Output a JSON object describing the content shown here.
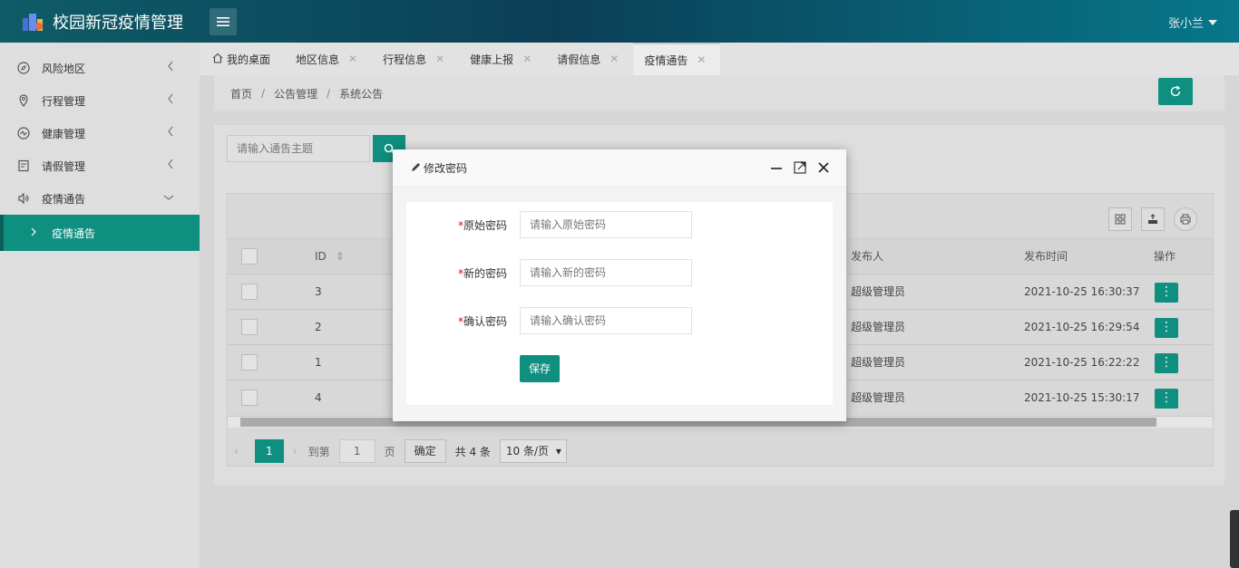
{
  "header": {
    "app_title": "校园新冠疫情管理",
    "user_name": "张小兰"
  },
  "sidebar": {
    "items": [
      {
        "label": "风险地区",
        "icon": "compass-icon"
      },
      {
        "label": "行程管理",
        "icon": "location-pin-icon"
      },
      {
        "label": "健康管理",
        "icon": "pulse-icon"
      },
      {
        "label": "请假管理",
        "icon": "clipboard-icon"
      },
      {
        "label": "疫情通告",
        "icon": "speaker-icon"
      }
    ],
    "sub_item": "疫情通告"
  },
  "tabs": [
    {
      "label": "我的桌面"
    },
    {
      "label": "地区信息"
    },
    {
      "label": "行程信息"
    },
    {
      "label": "健康上报"
    },
    {
      "label": "请假信息"
    },
    {
      "label": "疫情通告"
    }
  ],
  "breadcrumb": {
    "home": "首页",
    "section": "公告管理",
    "page": "系统公告",
    "separator": "/"
  },
  "search": {
    "placeholder": "请输入通告主题"
  },
  "table": {
    "columns": {
      "id": "ID",
      "publisher": "发布人",
      "time": "发布时间",
      "action": "操作"
    },
    "rows": [
      {
        "id": "3",
        "publisher": "超级管理员",
        "time": "2021-10-25 16:30:37"
      },
      {
        "id": "2",
        "publisher": "超级管理员",
        "time": "2021-10-25 16:29:54"
      },
      {
        "id": "1",
        "publisher": "超级管理员",
        "time": "2021-10-25 16:22:22"
      },
      {
        "id": "4",
        "publisher": "超级管理员",
        "time": "2021-10-25 15:30:17"
      }
    ]
  },
  "pager": {
    "current": "1",
    "goto_label": "到第",
    "goto_value": "1",
    "page_unit": "页",
    "confirm": "确定",
    "total": "共 4 条",
    "page_size": "10 条/页"
  },
  "modal": {
    "title": "修改密码",
    "fields": [
      {
        "label": "原始密码",
        "placeholder": "请输入原始密码"
      },
      {
        "label": "新的密码",
        "placeholder": "请输入新的密码"
      },
      {
        "label": "确认密码",
        "placeholder": "请输入确认密码"
      }
    ],
    "required_mark": "*",
    "save": "保存"
  },
  "colors": {
    "accent": "#0e8f80",
    "header_start": "#0e5c68",
    "header_end": "#07778a"
  }
}
